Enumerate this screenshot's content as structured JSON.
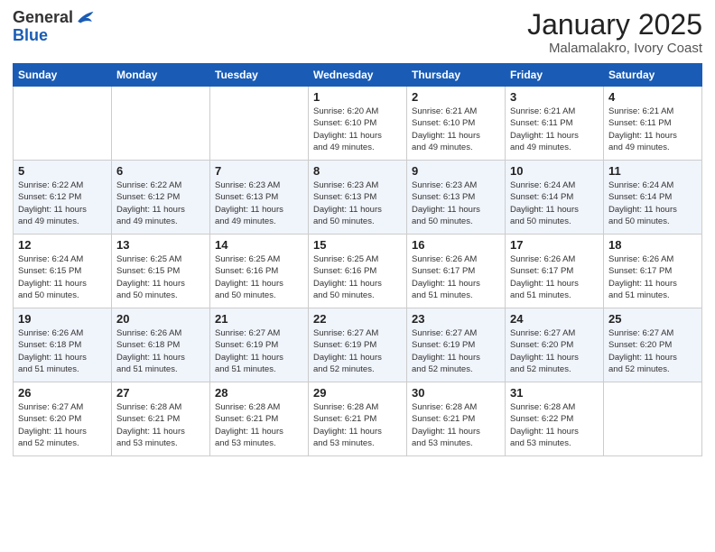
{
  "logo": {
    "general": "General",
    "blue": "Blue"
  },
  "title": {
    "month": "January 2025",
    "location": "Malamalakro, Ivory Coast"
  },
  "days_header": [
    "Sunday",
    "Monday",
    "Tuesday",
    "Wednesday",
    "Thursday",
    "Friday",
    "Saturday"
  ],
  "weeks": [
    [
      {
        "day": "",
        "info": ""
      },
      {
        "day": "",
        "info": ""
      },
      {
        "day": "",
        "info": ""
      },
      {
        "day": "1",
        "info": "Sunrise: 6:20 AM\nSunset: 6:10 PM\nDaylight: 11 hours\nand 49 minutes."
      },
      {
        "day": "2",
        "info": "Sunrise: 6:21 AM\nSunset: 6:10 PM\nDaylight: 11 hours\nand 49 minutes."
      },
      {
        "day": "3",
        "info": "Sunrise: 6:21 AM\nSunset: 6:11 PM\nDaylight: 11 hours\nand 49 minutes."
      },
      {
        "day": "4",
        "info": "Sunrise: 6:21 AM\nSunset: 6:11 PM\nDaylight: 11 hours\nand 49 minutes."
      }
    ],
    [
      {
        "day": "5",
        "info": "Sunrise: 6:22 AM\nSunset: 6:12 PM\nDaylight: 11 hours\nand 49 minutes."
      },
      {
        "day": "6",
        "info": "Sunrise: 6:22 AM\nSunset: 6:12 PM\nDaylight: 11 hours\nand 49 minutes."
      },
      {
        "day": "7",
        "info": "Sunrise: 6:23 AM\nSunset: 6:13 PM\nDaylight: 11 hours\nand 49 minutes."
      },
      {
        "day": "8",
        "info": "Sunrise: 6:23 AM\nSunset: 6:13 PM\nDaylight: 11 hours\nand 50 minutes."
      },
      {
        "day": "9",
        "info": "Sunrise: 6:23 AM\nSunset: 6:13 PM\nDaylight: 11 hours\nand 50 minutes."
      },
      {
        "day": "10",
        "info": "Sunrise: 6:24 AM\nSunset: 6:14 PM\nDaylight: 11 hours\nand 50 minutes."
      },
      {
        "day": "11",
        "info": "Sunrise: 6:24 AM\nSunset: 6:14 PM\nDaylight: 11 hours\nand 50 minutes."
      }
    ],
    [
      {
        "day": "12",
        "info": "Sunrise: 6:24 AM\nSunset: 6:15 PM\nDaylight: 11 hours\nand 50 minutes."
      },
      {
        "day": "13",
        "info": "Sunrise: 6:25 AM\nSunset: 6:15 PM\nDaylight: 11 hours\nand 50 minutes."
      },
      {
        "day": "14",
        "info": "Sunrise: 6:25 AM\nSunset: 6:16 PM\nDaylight: 11 hours\nand 50 minutes."
      },
      {
        "day": "15",
        "info": "Sunrise: 6:25 AM\nSunset: 6:16 PM\nDaylight: 11 hours\nand 50 minutes."
      },
      {
        "day": "16",
        "info": "Sunrise: 6:26 AM\nSunset: 6:17 PM\nDaylight: 11 hours\nand 51 minutes."
      },
      {
        "day": "17",
        "info": "Sunrise: 6:26 AM\nSunset: 6:17 PM\nDaylight: 11 hours\nand 51 minutes."
      },
      {
        "day": "18",
        "info": "Sunrise: 6:26 AM\nSunset: 6:17 PM\nDaylight: 11 hours\nand 51 minutes."
      }
    ],
    [
      {
        "day": "19",
        "info": "Sunrise: 6:26 AM\nSunset: 6:18 PM\nDaylight: 11 hours\nand 51 minutes."
      },
      {
        "day": "20",
        "info": "Sunrise: 6:26 AM\nSunset: 6:18 PM\nDaylight: 11 hours\nand 51 minutes."
      },
      {
        "day": "21",
        "info": "Sunrise: 6:27 AM\nSunset: 6:19 PM\nDaylight: 11 hours\nand 51 minutes."
      },
      {
        "day": "22",
        "info": "Sunrise: 6:27 AM\nSunset: 6:19 PM\nDaylight: 11 hours\nand 52 minutes."
      },
      {
        "day": "23",
        "info": "Sunrise: 6:27 AM\nSunset: 6:19 PM\nDaylight: 11 hours\nand 52 minutes."
      },
      {
        "day": "24",
        "info": "Sunrise: 6:27 AM\nSunset: 6:20 PM\nDaylight: 11 hours\nand 52 minutes."
      },
      {
        "day": "25",
        "info": "Sunrise: 6:27 AM\nSunset: 6:20 PM\nDaylight: 11 hours\nand 52 minutes."
      }
    ],
    [
      {
        "day": "26",
        "info": "Sunrise: 6:27 AM\nSunset: 6:20 PM\nDaylight: 11 hours\nand 52 minutes."
      },
      {
        "day": "27",
        "info": "Sunrise: 6:28 AM\nSunset: 6:21 PM\nDaylight: 11 hours\nand 53 minutes."
      },
      {
        "day": "28",
        "info": "Sunrise: 6:28 AM\nSunset: 6:21 PM\nDaylight: 11 hours\nand 53 minutes."
      },
      {
        "day": "29",
        "info": "Sunrise: 6:28 AM\nSunset: 6:21 PM\nDaylight: 11 hours\nand 53 minutes."
      },
      {
        "day": "30",
        "info": "Sunrise: 6:28 AM\nSunset: 6:21 PM\nDaylight: 11 hours\nand 53 minutes."
      },
      {
        "day": "31",
        "info": "Sunrise: 6:28 AM\nSunset: 6:22 PM\nDaylight: 11 hours\nand 53 minutes."
      },
      {
        "day": "",
        "info": ""
      }
    ]
  ]
}
